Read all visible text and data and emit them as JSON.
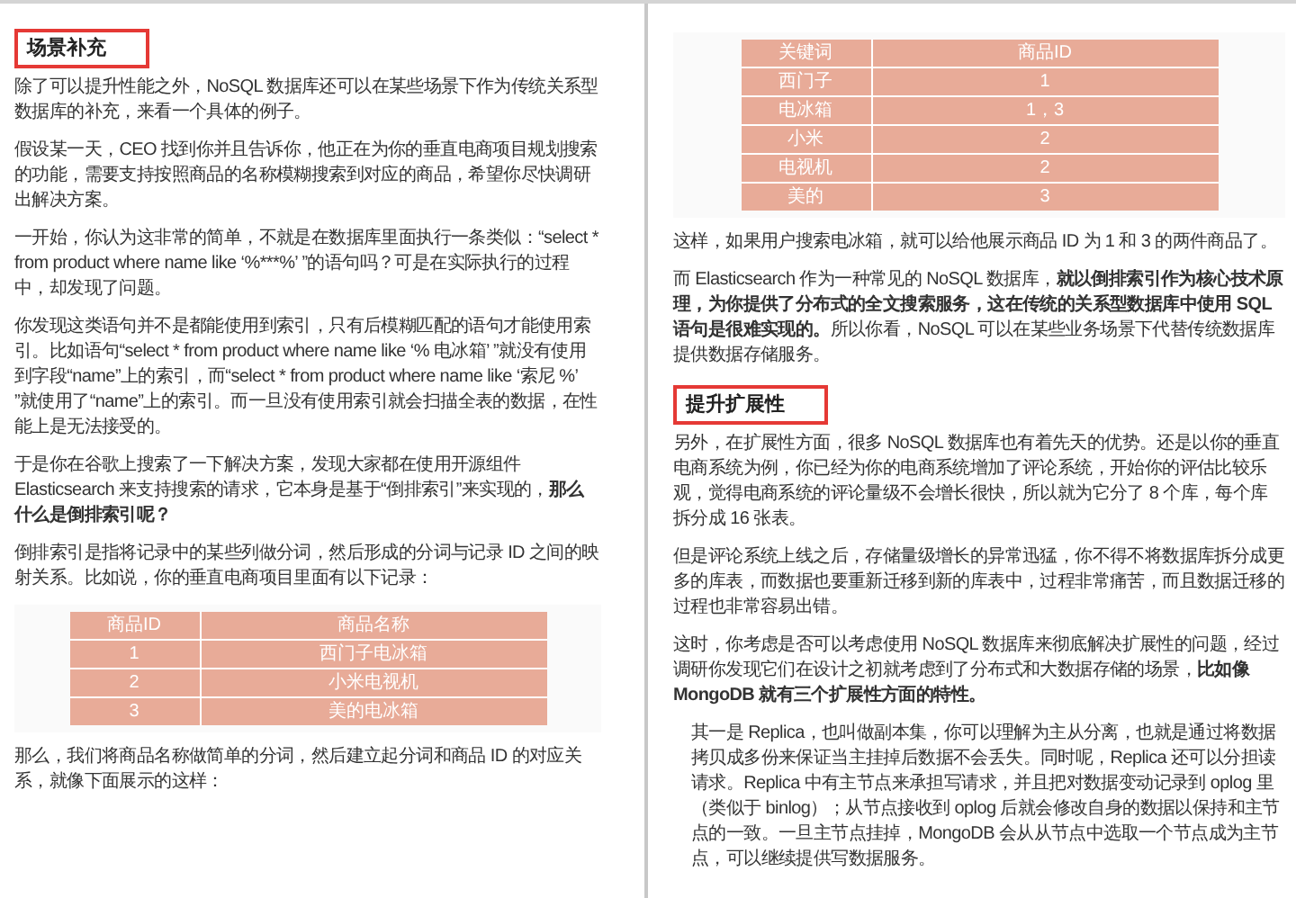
{
  "pages": [
    {
      "blocks": [
        {
          "kind": "heading",
          "text": "场景补充"
        },
        {
          "kind": "paragraph",
          "text": "除了可以提升性能之外，NoSQL 数据库还可以在某些场景下作为传统关系型数据库的补充，来看一个具体的例子。"
        },
        {
          "kind": "paragraph",
          "text": "假设某一天，CEO 找到你并且告诉你，他正在为你的垂直电商项目规划搜索的功能，需要支持按照商品的名称模糊搜索到对应的商品，希望你尽快调研出解决方案。"
        },
        {
          "kind": "paragraph",
          "text": "一开始，你认为这非常的简单，不就是在数据库里面执行一条类似：“select * from product where name like ‘%***%’ ”的语句吗？可是在实际执行的过程中，却发现了问题。"
        },
        {
          "kind": "paragraph",
          "text": "你发现这类语句并不是都能使用到索引，只有后模糊匹配的语句才能使用索引。比如语句“select * from product where name like ‘% 电冰箱’ ”就没有使用到字段“name”上的索引，而“select * from product where name like ‘索尼 %’ ”就使用了“name”上的索引。而一旦没有使用索引就会扫描全表的数据，在性能上是无法接受的。"
        },
        {
          "kind": "paragraph",
          "text": "于是你在谷歌上搜索了一下解决方案，发现大家都在使用开源组件 Elasticsearch 来支持搜索的请求，它本身是基于“倒排索引”来实现的，**那么什么是倒排索引呢？**"
        },
        {
          "kind": "paragraph",
          "text": "倒排索引是指将记录中的某些列做分词，然后形成的分词与记录 ID 之间的映射关系。比如说，你的垂直电商项目里面有以下记录："
        },
        {
          "kind": "table",
          "columns": [
            "商品ID",
            "商品名称"
          ],
          "rows": [
            [
              "1",
              "西门子电冰箱"
            ],
            [
              "2",
              "小米电视机"
            ],
            [
              "3",
              "美的电冰箱"
            ]
          ]
        },
        {
          "kind": "paragraph",
          "text": "那么，我们将商品名称做简单的分词，然后建立起分词和商品 ID 的对应关系，就像下面展示的这样："
        }
      ]
    },
    {
      "blocks": [
        {
          "kind": "table",
          "columns": [
            "关键词",
            "商品ID"
          ],
          "rows": [
            [
              "西门子",
              "1"
            ],
            [
              "电冰箱",
              "1，3"
            ],
            [
              "小米",
              "2"
            ],
            [
              "电视机",
              "2"
            ],
            [
              "美的",
              "3"
            ]
          ]
        },
        {
          "kind": "paragraph",
          "text": "这样，如果用户搜索电冰箱，就可以给他展示商品 ID 为 1 和 3 的两件商品了。"
        },
        {
          "kind": "paragraph",
          "text": "而 Elasticsearch 作为一种常见的 NoSQL 数据库，**就以倒排索引作为核心技术原理，为你提供了分布式的全文搜索服务，这在传统的关系型数据库中使用 SQL 语句是很难实现的。**所以你看，NoSQL 可以在某些业务场景下代替传统数据库提供数据存储服务。"
        },
        {
          "kind": "heading",
          "text": "提升扩展性"
        },
        {
          "kind": "paragraph",
          "text": "另外，在扩展性方面，很多 NoSQL 数据库也有着先天的优势。还是以你的垂直电商系统为例，你已经为你的电商系统增加了评论系统，开始你的评估比较乐观，觉得电商系统的评论量级不会增长很快，所以就为它分了 8 个库，每个库拆分成 16 张表。"
        },
        {
          "kind": "paragraph",
          "text": "但是评论系统上线之后，存储量级增长的异常迅猛，你不得不将数据库拆分成更多的库表，而数据也要重新迁移到新的库表中，过程非常痛苦，而且数据迁移的过程也非常容易出错。"
        },
        {
          "kind": "paragraph",
          "text": "这时，你考虑是否可以考虑使用 NoSQL 数据库来彻底解决扩展性的问题，经过调研你发现它们在设计之初就考虑到了分布式和大数据存储的场景，**比如像 MongoDB 就有三个扩展性方面的特性。**"
        },
        {
          "kind": "quote",
          "text": "其一是 Replica，也叫做副本集，你可以理解为主从分离，也就是通过将数据拷贝成多份来保证当主挂掉后数据不会丢失。同时呢，Replica 还可以分担读请求。Replica 中有主节点来承担写请求，并且把对数据变动记录到 oplog 里（类似于 binlog）；从节点接收到 oplog 后就会修改自身的数据以保持和主节点的一致。一旦主节点挂掉，MongoDB 会从从节点中选取一个节点成为主节点，可以继续提供写数据服务。"
        }
      ]
    }
  ]
}
